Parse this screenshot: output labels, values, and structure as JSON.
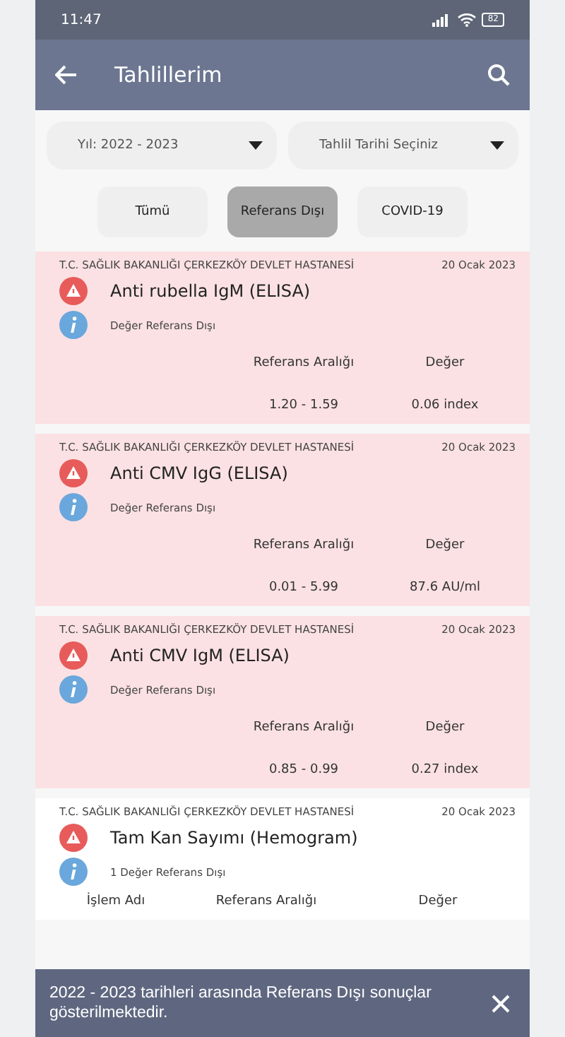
{
  "status_bar": {
    "time": "11:47",
    "battery": "82"
  },
  "app_bar": {
    "title": "Tahlillerim"
  },
  "filters": [
    {
      "label": "Yıl: 2022 - 2023"
    },
    {
      "label": "Tahlil Tarihi Seçiniz"
    }
  ],
  "tabs": [
    {
      "label": "Tümü",
      "selected": false
    },
    {
      "label": "Referans Dışı",
      "selected": true
    },
    {
      "label": "COVID-19",
      "selected": false
    }
  ],
  "results": [
    {
      "kind": "out_of_range",
      "hospital": "T.C. SAĞLIK BAKANLIĞI ÇERKEZKÖY DEVLET HASTANESİ",
      "date": "20 Ocak 2023",
      "title": "Anti rubella IgM (ELISA)",
      "note": "Değer Referans Dışı",
      "columns": [
        "Referans Aralığı",
        "Değer"
      ],
      "values": [
        "1.20 - 1.59",
        "0.06 index"
      ]
    },
    {
      "kind": "out_of_range",
      "hospital": "T.C. SAĞLIK BAKANLIĞI ÇERKEZKÖY DEVLET HASTANESİ",
      "date": "20 Ocak 2023",
      "title": "Anti CMV IgG (ELISA)",
      "note": "Değer Referans Dışı",
      "columns": [
        "Referans Aralığı",
        "Değer"
      ],
      "values": [
        "0.01 - 5.99",
        "87.6 AU/ml"
      ]
    },
    {
      "kind": "out_of_range",
      "hospital": "T.C. SAĞLIK BAKANLIĞI ÇERKEZKÖY DEVLET HASTANESİ",
      "date": "20 Ocak 2023",
      "title": "Anti CMV IgM (ELISA)",
      "note": "Değer Referans Dışı",
      "columns": [
        "Referans Aralığı",
        "Değer"
      ],
      "values": [
        "0.85 - 0.99",
        "0.27 index"
      ]
    },
    {
      "kind": "panel",
      "hospital": "T.C. SAĞLIK BAKANLIĞI ÇERKEZKÖY DEVLET HASTANESİ",
      "date": "20 Ocak 2023",
      "title": "Tam Kan Sayımı (Hemogram)",
      "note": "1 Değer Referans Dışı",
      "columns": [
        "İşlem Adı",
        "Referans Aralığı",
        "Değer"
      ]
    }
  ],
  "snackbar": {
    "message": "2022 - 2023 tarihleri arasında Referans Dışı sonuçlar gösterilmektedir."
  }
}
